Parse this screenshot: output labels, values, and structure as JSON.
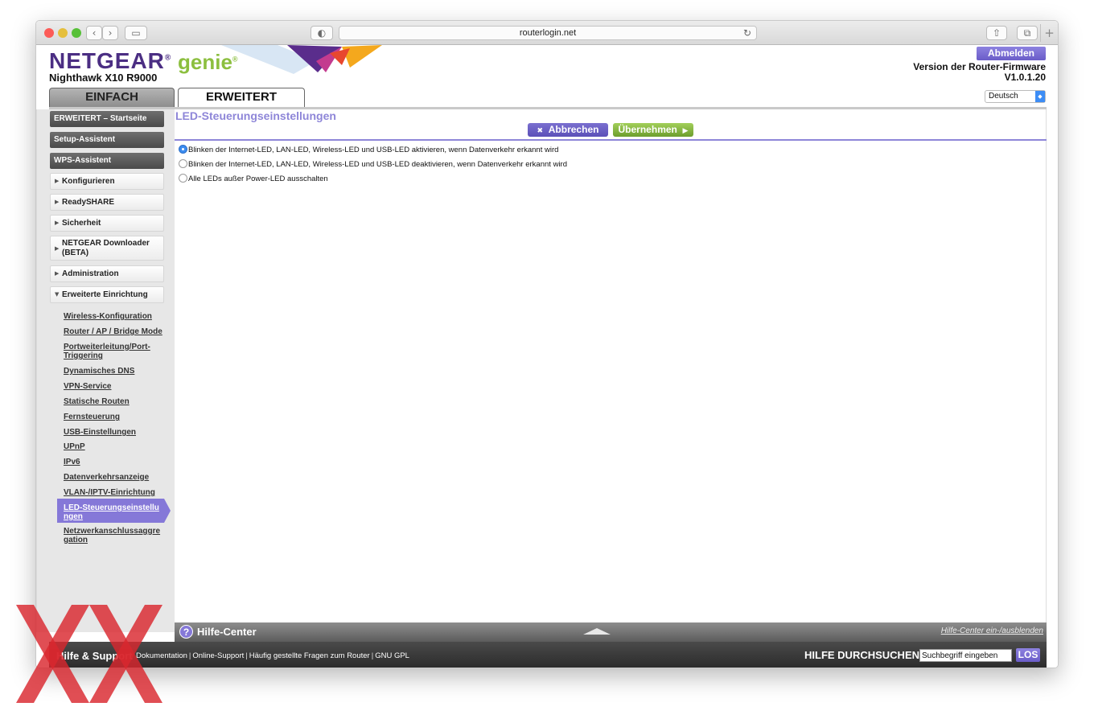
{
  "browser": {
    "url": "routerlogin.net",
    "traffic_colors": [
      "#fc5b57",
      "#e5bf3c",
      "#57c038"
    ]
  },
  "header": {
    "brand": "NETGEAR",
    "brand_reg": "®",
    "product": "genie",
    "product_reg": "®",
    "model": "Nighthawk X10 R9000",
    "logout_label": "Abmelden",
    "firmware_label": "Version der Router-Firmware",
    "firmware_version": "V1.0.1.20",
    "language": "Deutsch"
  },
  "tabs": [
    {
      "label": "EINFACH"
    },
    {
      "label": "ERWEITERT"
    }
  ],
  "sidebar": {
    "top_items": [
      {
        "label": "ERWEITERT – Startseite"
      },
      {
        "label": "Setup-Assistent"
      },
      {
        "label": "WPS-Assistent"
      }
    ],
    "sections": [
      {
        "label": "Konfigurieren"
      },
      {
        "label": "ReadySHARE"
      },
      {
        "label": "Sicherheit"
      },
      {
        "label": "NETGEAR Downloader (BETA)"
      },
      {
        "label": "Administration"
      },
      {
        "label": "Erweiterte Einrichtung"
      }
    ],
    "sub_items": [
      {
        "label": "Wireless-Konfiguration"
      },
      {
        "label": "Router / AP / Bridge Mode"
      },
      {
        "label": "Portweiterleitung/Port-Triggering"
      },
      {
        "label": "Dynamisches DNS"
      },
      {
        "label": "VPN-Service"
      },
      {
        "label": "Statische Routen"
      },
      {
        "label": "Fernsteuerung"
      },
      {
        "label": "USB-Einstellungen"
      },
      {
        "label": "UPnP"
      },
      {
        "label": "IPv6"
      },
      {
        "label": "Datenverkehrsanzeige"
      },
      {
        "label": "VLAN-/IPTV-Einrichtung"
      },
      {
        "label": "LED-Steuerungseinstellungen"
      },
      {
        "label": "Netzwerkanschlussaggregation"
      }
    ]
  },
  "main": {
    "title": "LED-Steuerungseinstellungen",
    "cancel_label": "Abbrechen",
    "apply_label": "Übernehmen",
    "options": [
      {
        "label": "Blinken der Internet-LED, LAN-LED, Wireless-LED und USB-LED aktivieren, wenn Datenverkehr erkannt wird",
        "selected": true
      },
      {
        "label": "Blinken der Internet-LED, LAN-LED, Wireless-LED und USB-LED deaktivieren, wenn Datenverkehr erkannt wird",
        "selected": false
      },
      {
        "label": "Alle LEDs außer Power-LED ausschalten",
        "selected": false
      }
    ]
  },
  "help": {
    "title": "Hilfe-Center",
    "toggle_label": "Hilfe-Center ein-/ausblenden"
  },
  "footer": {
    "title": "Hilfe & Support",
    "links": [
      "Dokumentation",
      "Online-Support",
      "Häufig gestellte Fragen zum Router",
      "GNU GPL"
    ],
    "search_label": "HILFE DURCHSUCHEN",
    "search_value": "Suchbegriff eingeben",
    "search_button": "LOS"
  },
  "colors": {
    "netgear_purple": "#4b2e83",
    "genie_green": "#8cbf3f",
    "accent_purple": "#8578d8",
    "watermark_red": "#d9272e"
  }
}
